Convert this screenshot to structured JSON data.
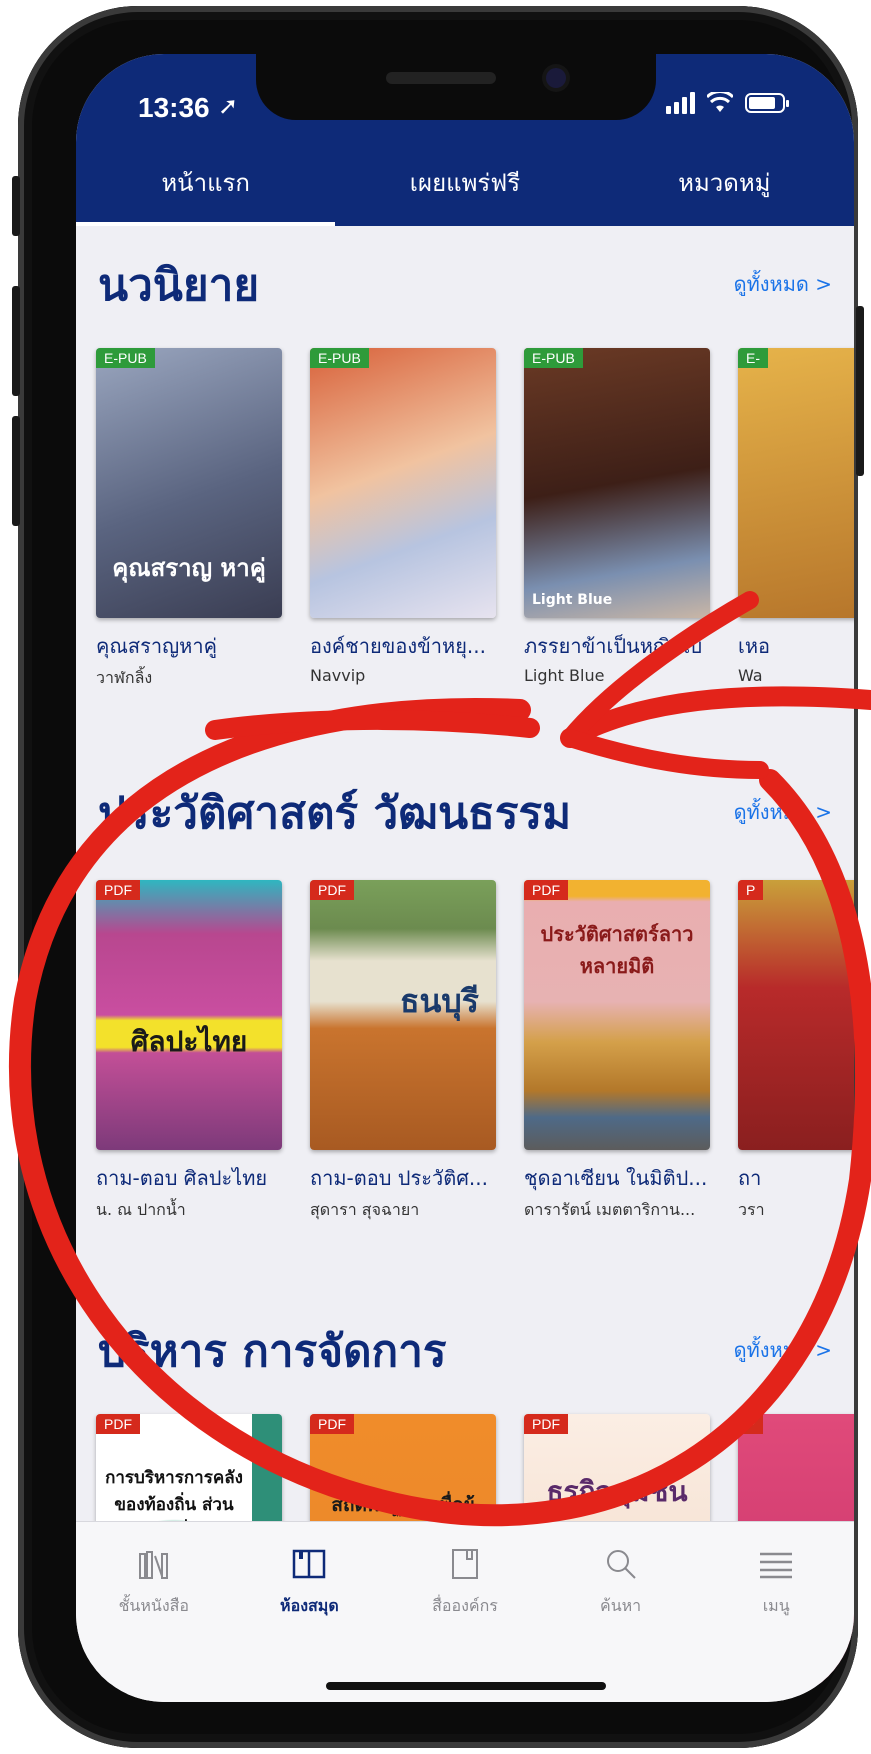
{
  "status": {
    "time": "13:36"
  },
  "tabs": [
    {
      "label": "หน้าแรก",
      "active": true
    },
    {
      "label": "เผยแพร่ฟรี",
      "active": false
    },
    {
      "label": "หมวดหมู่",
      "active": false
    }
  ],
  "sections": [
    {
      "title": "นวนิยาย",
      "see_all": "ดูทั้งหมด >",
      "books": [
        {
          "badge": "E-PUB",
          "title": "คุณสราญหาคู่",
          "author": "วาฬกลิ้ง",
          "cover_color": "#6f7a95",
          "cover_text": "คุณสราญ หาคู่"
        },
        {
          "badge": "E-PUB",
          "title": "องค์ชายของข้าหยุ...",
          "author": "Navvip",
          "cover_color": "#c65c3a",
          "cover_text": ""
        },
        {
          "badge": "E-PUB",
          "title": "ภรรยาข้าเป็นหญิงใบ้",
          "author": "Light Blue",
          "cover_color": "#4a2a1e",
          "cover_text": "Light Blue"
        },
        {
          "badge": "E-",
          "title": "เหอ",
          "author": "Wa",
          "cover_color": "#d9a23a",
          "cover_text": ""
        }
      ]
    },
    {
      "title": "ประวัติศาสตร์ วัฒนธรรม",
      "see_all": "ดูทั้งหมด >",
      "books": [
        {
          "badge": "PDF",
          "title": "ถาม-ตอบ ศิลปะไทย",
          "author": "น. ณ ปากน้ำ",
          "cover_color": "#b8478f",
          "cover_text": "ศิลปะไทย"
        },
        {
          "badge": "PDF",
          "title": "ถาม-ตอบ ประวัติศ...",
          "author": "สุดารา สุจฉายา",
          "cover_color": "#c46a2c",
          "cover_text": "ธนบุรี"
        },
        {
          "badge": "PDF",
          "title": "ชุดอาเซียน ในมิติป...",
          "author": "ดารารัตน์ เมตตาริกาน...",
          "cover_color": "#e2a9a6",
          "cover_text": "ประวัติศาสตร์ลาว หลายมิติ"
        },
        {
          "badge": "P",
          "title": "ถา",
          "author": "วรา",
          "cover_color": "#b82a2a",
          "cover_text": ""
        }
      ]
    },
    {
      "title": "บริหาร การจัดการ",
      "see_all": "ดูทั้งหมด >",
      "books": [
        {
          "badge": "PDF",
          "title": "",
          "author": "",
          "cover_color": "#2e8f78",
          "cover_text": "การบริหารการคลัง ของท้องถิ่น ส่วนท้องถิ่น"
        },
        {
          "badge": "PDF",
          "title": "",
          "author": "",
          "cover_color": "#e8862a",
          "cover_text": "สถิติพื้นฐาน เพื่อผู้บริหารท้องถิ่น"
        },
        {
          "badge": "PDF",
          "title": "",
          "author": "",
          "cover_color": "#f3e3d6",
          "cover_text": "ธุรกิจชุมชน"
        },
        {
          "badge": "P",
          "title": "",
          "author": "",
          "cover_color": "#e04a7a",
          "cover_text": ""
        }
      ]
    }
  ],
  "bottom_nav": [
    {
      "label": "ชั้นหนังสือ",
      "icon": "bookshelf-icon",
      "active": false
    },
    {
      "label": "ห้องสมุด",
      "icon": "library-icon",
      "active": true
    },
    {
      "label": "สื่อองค์กร",
      "icon": "book-icon",
      "active": false
    },
    {
      "label": "ค้นหา",
      "icon": "search-icon",
      "active": false
    },
    {
      "label": "เมนู",
      "icon": "menu-icon",
      "active": false
    }
  ],
  "colors": {
    "header": "#0e2a78",
    "accent": "#1a73e8",
    "annotation": "#e3231a"
  }
}
